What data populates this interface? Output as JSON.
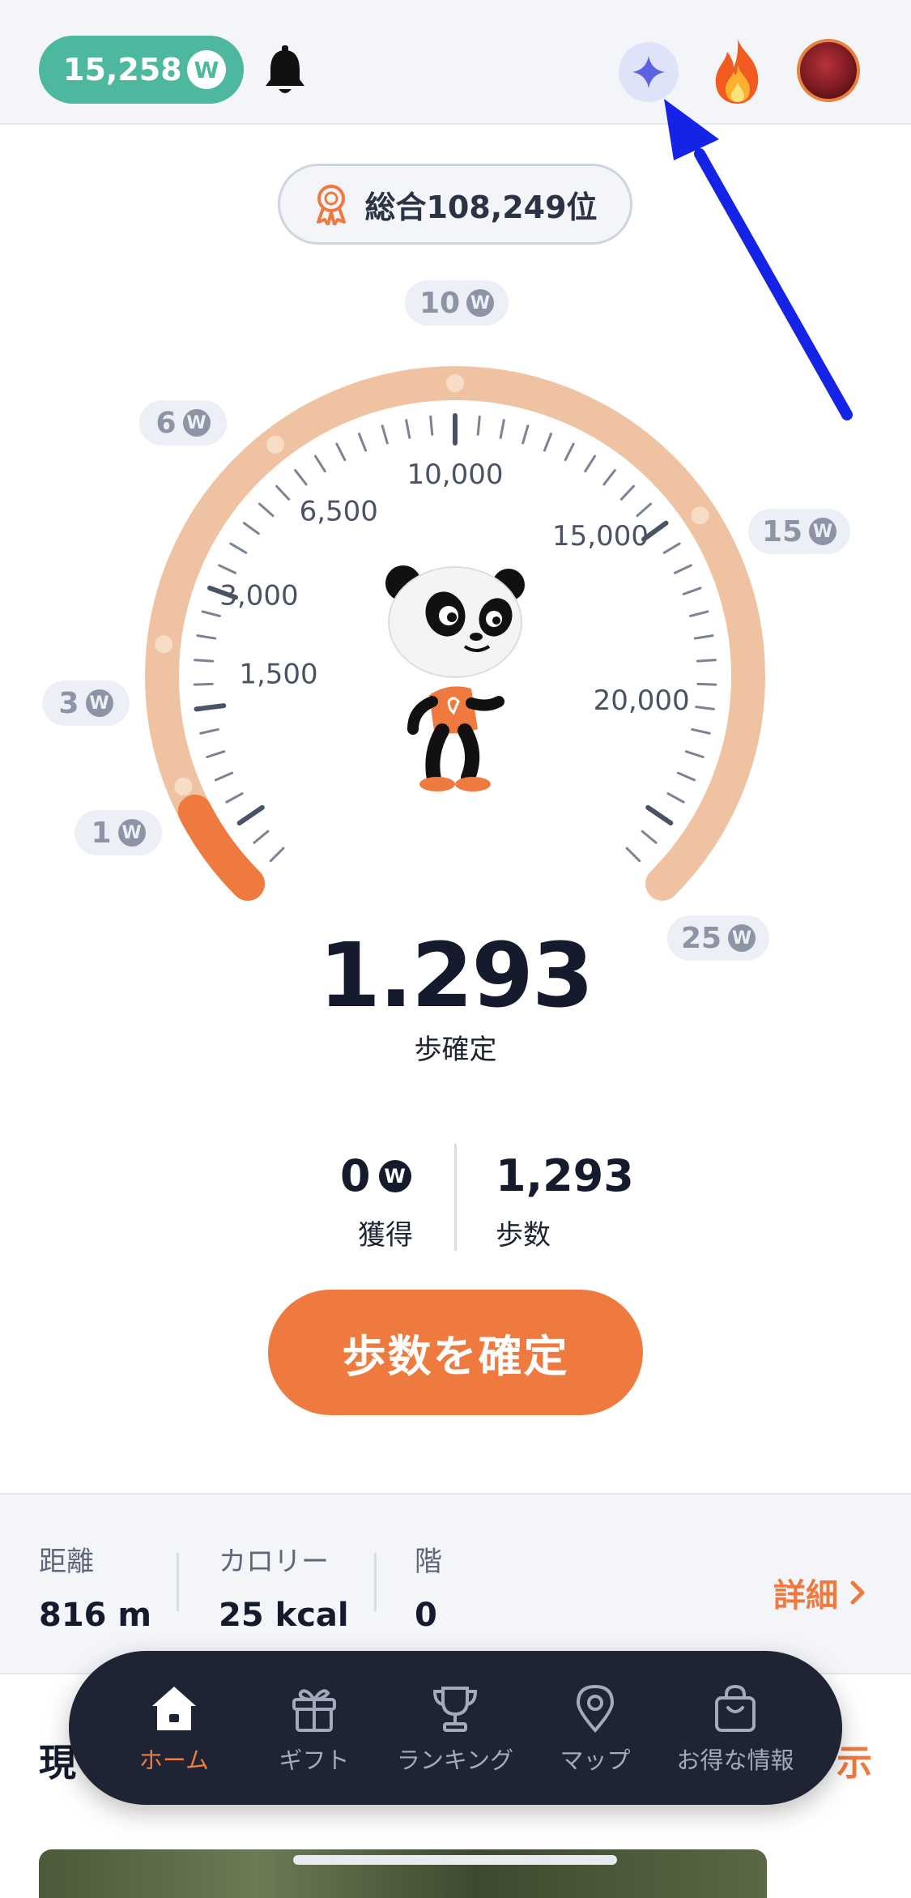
{
  "header": {
    "balance": "15,258",
    "coin_symbol": "W"
  },
  "rank": {
    "label": "総合108,249位"
  },
  "gauge": {
    "step_labels": [
      "1,500",
      "3,000",
      "6,500",
      "10,000",
      "15,000",
      "20,000"
    ],
    "rewards": [
      "1",
      "3",
      "6",
      "10",
      "15",
      "25"
    ],
    "progress_fraction": 0.065
  },
  "steps": {
    "confirmed_value": "1.293",
    "confirmed_label": "歩確定"
  },
  "stats": {
    "earned_value": "0",
    "earned_label": "獲得",
    "steps_value": "1,293",
    "steps_label": "歩数"
  },
  "confirm_button": {
    "label": "歩数を確定"
  },
  "metrics": {
    "distance_label": "距離",
    "distance_value": "816 m",
    "calorie_label": "カロリー",
    "calorie_value": "25 kcal",
    "floors_label": "階",
    "floors_value": "0",
    "detail_label": "詳細"
  },
  "section": {
    "title_partial": "現",
    "more_partial": "示"
  },
  "nav": {
    "items": [
      {
        "label": "ホーム",
        "icon": "home-icon"
      },
      {
        "label": "ギフト",
        "icon": "gift-icon"
      },
      {
        "label": "ランキング",
        "icon": "trophy-icon"
      },
      {
        "label": "マップ",
        "icon": "map-pin-icon"
      },
      {
        "label": "お得な情報",
        "icon": "shopping-bag-icon"
      }
    ]
  },
  "colors": {
    "accent": "#ee7a3f",
    "balance_green": "#4db89f",
    "navy": "#1e2433",
    "gauge_track": "#efc3a1"
  }
}
